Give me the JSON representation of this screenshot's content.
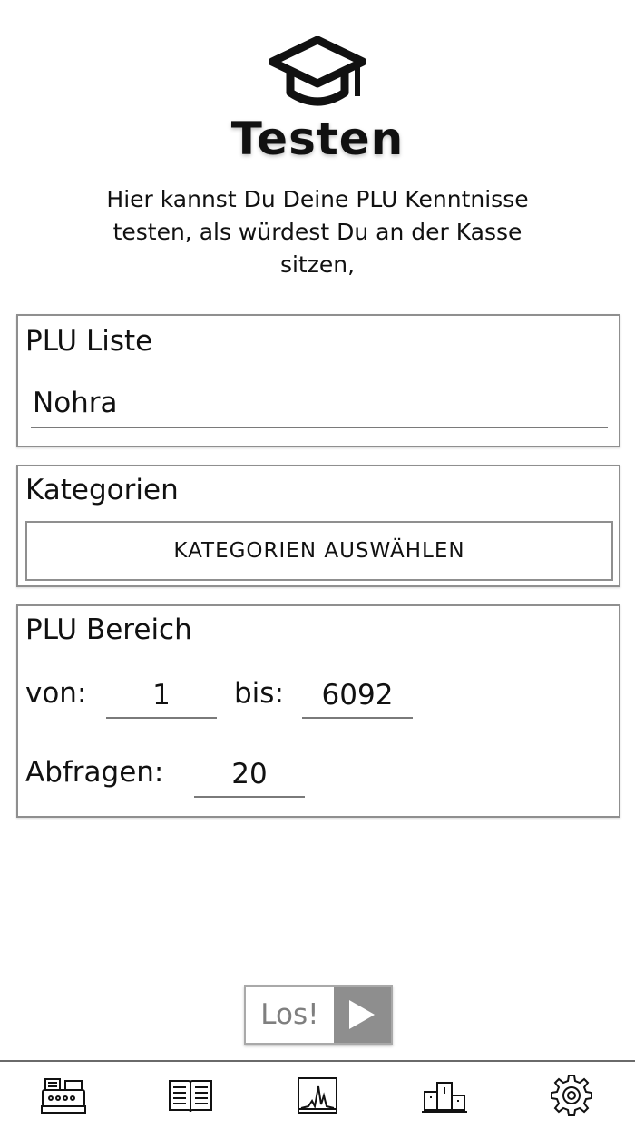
{
  "header": {
    "logo_icon": "graduation-cap-icon",
    "title": "Testen",
    "intro": "Hier kannst Du Deine PLU Kenntnisse testen, als würdest Du an der Kasse sitzen,"
  },
  "plu_liste": {
    "title": "PLU Liste",
    "value": "Nohra"
  },
  "kategorien": {
    "title": "Kategorien",
    "button_label": "KATEGORIEN AUSWÄHLEN"
  },
  "plu_bereich": {
    "title": "PLU Bereich",
    "von_label": "von:",
    "von_value": "1",
    "bis_label": "bis:",
    "bis_value": "6092",
    "abfragen_label": "Abfragen:",
    "abfragen_value": "20"
  },
  "start_button": {
    "label": "Los!",
    "icon": "play-icon"
  },
  "bottom_nav": {
    "items": [
      {
        "icon": "cash-register-icon"
      },
      {
        "icon": "book-icon"
      },
      {
        "icon": "chart-icon"
      },
      {
        "icon": "podium-icon"
      },
      {
        "icon": "gear-icon"
      }
    ]
  },
  "colors": {
    "border": "#8f8f8f",
    "play_bg": "#8e8e8e",
    "text": "#111111"
  }
}
